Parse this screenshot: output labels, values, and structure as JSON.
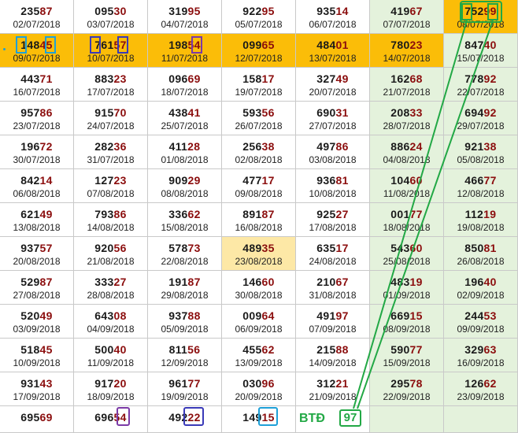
{
  "rows": [
    [
      {
        "number": "23587",
        "date": "02/07/2018"
      },
      {
        "number": "09530",
        "date": "03/07/2018"
      },
      {
        "number": "31995",
        "date": "04/07/2018"
      },
      {
        "number": "92295",
        "date": "05/07/2018"
      },
      {
        "number": "93514",
        "date": "06/07/2018"
      },
      {
        "number": "41967",
        "date": "07/07/2018"
      },
      {
        "number": "75299",
        "date": "08/07/2018"
      }
    ],
    [
      {
        "number": "14845",
        "date": "09/07/2018"
      },
      {
        "number": "76157",
        "date": "10/07/2018"
      },
      {
        "number": "19854",
        "date": "11/07/2018"
      },
      {
        "number": "09965",
        "date": "12/07/2018"
      },
      {
        "number": "48401",
        "date": "13/07/2018"
      },
      {
        "number": "78023",
        "date": "14/07/2018"
      },
      {
        "number": "84740",
        "date": "15/07/2018"
      }
    ],
    [
      {
        "number": "44371",
        "date": "16/07/2018"
      },
      {
        "number": "88323",
        "date": "17/07/2018"
      },
      {
        "number": "09669",
        "date": "18/07/2018"
      },
      {
        "number": "15817",
        "date": "19/07/2018"
      },
      {
        "number": "32749",
        "date": "20/07/2018"
      },
      {
        "number": "16268",
        "date": "21/07/2018"
      },
      {
        "number": "77892",
        "date": "22/07/2018"
      }
    ],
    [
      {
        "number": "95786",
        "date": "23/07/2018"
      },
      {
        "number": "91570",
        "date": "24/07/2018"
      },
      {
        "number": "43841",
        "date": "25/07/2018"
      },
      {
        "number": "59356",
        "date": "26/07/2018"
      },
      {
        "number": "69031",
        "date": "27/07/2018"
      },
      {
        "number": "20833",
        "date": "28/07/2018"
      },
      {
        "number": "69492",
        "date": "29/07/2018"
      }
    ],
    [
      {
        "number": "19672",
        "date": "30/07/2018"
      },
      {
        "number": "28236",
        "date": "31/07/2018"
      },
      {
        "number": "41128",
        "date": "01/08/2018"
      },
      {
        "number": "25638",
        "date": "02/08/2018"
      },
      {
        "number": "49786",
        "date": "03/08/2018"
      },
      {
        "number": "88624",
        "date": "04/08/2018"
      },
      {
        "number": "92138",
        "date": "05/08/2018"
      }
    ],
    [
      {
        "number": "84214",
        "date": "06/08/2018"
      },
      {
        "number": "12723",
        "date": "07/08/2018"
      },
      {
        "number": "90929",
        "date": "08/08/2018"
      },
      {
        "number": "47717",
        "date": "09/08/2018"
      },
      {
        "number": "93681",
        "date": "10/08/2018"
      },
      {
        "number": "10460",
        "date": "11/08/2018"
      },
      {
        "number": "46677",
        "date": "12/08/2018"
      }
    ],
    [
      {
        "number": "62149",
        "date": "13/08/2018"
      },
      {
        "number": "79386",
        "date": "14/08/2018"
      },
      {
        "number": "33662",
        "date": "15/08/2018"
      },
      {
        "number": "89187",
        "date": "16/08/2018"
      },
      {
        "number": "92527",
        "date": "17/08/2018"
      },
      {
        "number": "00177",
        "date": "18/08/2018"
      },
      {
        "number": "11219",
        "date": "19/08/2018"
      }
    ],
    [
      {
        "number": "93757",
        "date": "20/08/2018"
      },
      {
        "number": "92056",
        "date": "21/08/2018"
      },
      {
        "number": "57873",
        "date": "22/08/2018"
      },
      {
        "number": "48935",
        "date": "23/08/2018"
      },
      {
        "number": "63517",
        "date": "24/08/2018"
      },
      {
        "number": "54360",
        "date": "25/08/2018"
      },
      {
        "number": "85081",
        "date": "26/08/2018"
      }
    ],
    [
      {
        "number": "52987",
        "date": "27/08/2018"
      },
      {
        "number": "33327",
        "date": "28/08/2018"
      },
      {
        "number": "19187",
        "date": "29/08/2018"
      },
      {
        "number": "14660",
        "date": "30/08/2018"
      },
      {
        "number": "21067",
        "date": "31/08/2018"
      },
      {
        "number": "48319",
        "date": "01/09/2018"
      },
      {
        "number": "19640",
        "date": "02/09/2018"
      }
    ],
    [
      {
        "number": "52049",
        "date": "03/09/2018"
      },
      {
        "number": "64308",
        "date": "04/09/2018"
      },
      {
        "number": "93788",
        "date": "05/09/2018"
      },
      {
        "number": "00964",
        "date": "06/09/2018"
      },
      {
        "number": "49197",
        "date": "07/09/2018"
      },
      {
        "number": "66915",
        "date": "08/09/2018"
      },
      {
        "number": "24453",
        "date": "09/09/2018"
      }
    ],
    [
      {
        "number": "51845",
        "date": "10/09/2018"
      },
      {
        "number": "50040",
        "date": "11/09/2018"
      },
      {
        "number": "81156",
        "date": "12/09/2018"
      },
      {
        "number": "45562",
        "date": "13/09/2018"
      },
      {
        "number": "21588",
        "date": "14/09/2018"
      },
      {
        "number": "59077",
        "date": "15/09/2018"
      },
      {
        "number": "32963",
        "date": "16/09/2018"
      }
    ],
    [
      {
        "number": "93143",
        "date": "17/09/2018"
      },
      {
        "number": "91720",
        "date": "18/09/2018"
      },
      {
        "number": "96177",
        "date": "19/09/2018"
      },
      {
        "number": "03096",
        "date": "20/09/2018"
      },
      {
        "number": "31221",
        "date": "21/09/2018"
      },
      {
        "number": "29578",
        "date": "22/09/2018"
      },
      {
        "number": "12662",
        "date": "23/09/2018"
      }
    ],
    [
      {
        "number": "69569",
        "date": ""
      },
      {
        "number": "69654",
        "date": ""
      },
      {
        "number": "49222",
        "date": ""
      },
      {
        "number": "14915",
        "date": ""
      },
      {
        "number": "",
        "date": ""
      },
      {
        "number": "",
        "date": ""
      },
      {
        "number": "",
        "date": ""
      }
    ]
  ],
  "colors": {
    "green_column": "#e4f2dc",
    "orange_row": "#fbbd08",
    "yellow_cell": "#fde8a6",
    "digit_tail": "#8b0d0d",
    "annot_green": "#22a845",
    "annot_blue": "#1ea0d8",
    "annot_purple": "#7b3aa6",
    "annot_navy": "#3a3ab8"
  },
  "highlights": {
    "orange_row_index": 1,
    "yellow_cell": {
      "row": 7,
      "col": 3
    }
  },
  "annotation": {
    "label": "BTĐ",
    "value": "97"
  }
}
